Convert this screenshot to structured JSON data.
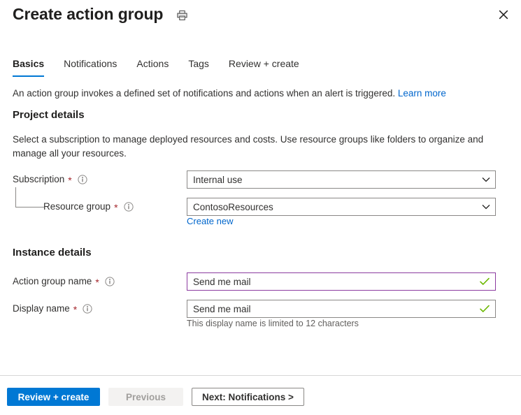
{
  "header": {
    "title": "Create action group",
    "print_icon": "printer-icon",
    "close_icon": "close-icon"
  },
  "tabs": [
    {
      "label": "Basics",
      "active": true
    },
    {
      "label": "Notifications",
      "active": false
    },
    {
      "label": "Actions",
      "active": false
    },
    {
      "label": "Tags",
      "active": false
    },
    {
      "label": "Review + create",
      "active": false
    }
  ],
  "intro": {
    "text": "An action group invokes a defined set of notifications and actions when an alert is triggered.",
    "link_label": "Learn more"
  },
  "project_details": {
    "heading": "Project details",
    "description": "Select a subscription to manage deployed resources and costs. Use resource groups like folders to organize and manage all your resources.",
    "subscription": {
      "label": "Subscription",
      "required_marker": "*",
      "info_icon": "info-icon",
      "value": "Internal use",
      "chevron_icon": "chevron-down-icon"
    },
    "resource_group": {
      "label": "Resource group",
      "required_marker": "*",
      "info_icon": "info-icon",
      "value": "ContosoResources",
      "chevron_icon": "chevron-down-icon",
      "create_new_label": "Create new"
    }
  },
  "instance_details": {
    "heading": "Instance details",
    "action_group_name": {
      "label": "Action group name",
      "required_marker": "*",
      "info_icon": "info-icon",
      "value": "Send me mail",
      "validation_icon": "check-icon"
    },
    "display_name": {
      "label": "Display name",
      "required_marker": "*",
      "info_icon": "info-icon",
      "value": "Send me mail",
      "validation_icon": "check-icon",
      "helper_text": "This display name is limited to 12 characters"
    }
  },
  "footer": {
    "review_create_label": "Review + create",
    "previous_label": "Previous",
    "next_label": "Next: Notifications >"
  },
  "colors": {
    "accent": "#0078d4",
    "link": "#0066cc",
    "required": "#a4262c",
    "valid_border": "#8c3ba0",
    "valid_check": "#6bb700"
  }
}
